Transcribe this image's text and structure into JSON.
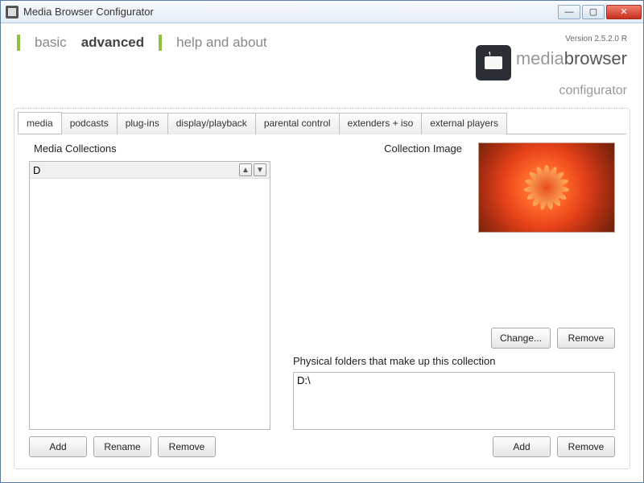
{
  "window": {
    "title": "Media Browser Configurator"
  },
  "header": {
    "nav": {
      "basic": "basic",
      "advanced": "advanced",
      "help": "help and about"
    },
    "version": "Version 2.5.2.0 R",
    "brand_light": "media",
    "brand_dark": "browser",
    "brand_sub": "configurator"
  },
  "tabs": {
    "media": "media",
    "podcasts": "podcasts",
    "plugins": "plug-ins",
    "display": "display/playback",
    "parental": "parental control",
    "extenders": "extenders + iso",
    "external": "external players"
  },
  "media_panel": {
    "collections_label": "Media Collections",
    "collection_image_label": "Collection Image",
    "physical_label": "Physical folders that make up this collection",
    "collections": [
      {
        "name": "D"
      }
    ],
    "folders": [
      "D:\\"
    ],
    "buttons": {
      "add": "Add",
      "rename": "Rename",
      "remove": "Remove",
      "change": "Change...",
      "remove_img": "Remove",
      "add_folder": "Add",
      "remove_folder": "Remove"
    }
  }
}
